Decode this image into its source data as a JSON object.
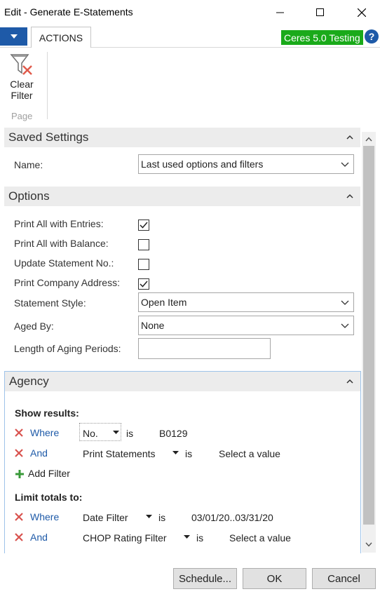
{
  "window": {
    "title": "Edit - Generate E-Statements",
    "minimize_icon": "minimize-icon",
    "maximize_icon": "maximize-icon",
    "close_icon": "close-icon"
  },
  "ribbon": {
    "menu_icon": "dropdown-arrow-icon",
    "tab_actions": "ACTIONS",
    "env_badge": "Ceres 5.0 Testing",
    "env_badge_color": "#1aaa1a",
    "help_icon": "help-icon",
    "help_glyph": "?",
    "clear_filter_line1": "Clear",
    "clear_filter_line2": "Filter",
    "group_label": "Page"
  },
  "saved_settings": {
    "title": "Saved Settings",
    "name_label": "Name:",
    "name_value": "Last used options and filters"
  },
  "options": {
    "title": "Options",
    "fields": [
      {
        "label": "Print All with Entries:",
        "checked": true
      },
      {
        "label": "Print All with Balance:",
        "checked": false
      },
      {
        "label": "Update Statement No.:",
        "checked": false
      },
      {
        "label": "Print Company Address:",
        "checked": true
      }
    ],
    "statement_style_label": "Statement Style:",
    "statement_style_value": "Open Item",
    "aged_by_label": "Aged By:",
    "aged_by_value": "None",
    "aging_periods_label": "Length of Aging Periods:",
    "aging_periods_value": ""
  },
  "agency": {
    "title": "Agency",
    "show_results_heading": "Show results:",
    "show_results": [
      {
        "keyword": "Where",
        "field": "No.",
        "op": "is",
        "value": "B0129"
      },
      {
        "keyword": "And",
        "field": "Print Statements",
        "op": "is",
        "value": "Select a value"
      }
    ],
    "add_filter_label": "Add Filter",
    "limit_totals_heading": "Limit totals to:",
    "limit_totals": [
      {
        "keyword": "Where",
        "field": "Date Filter",
        "op": "is",
        "value": "03/01/20..03/31/20"
      },
      {
        "keyword": "And",
        "field": "CHOP Rating Filter",
        "op": "is",
        "value": "Select a value"
      }
    ]
  },
  "footer": {
    "schedule_label": "Schedule...",
    "ok_label": "OK",
    "cancel_label": "Cancel"
  },
  "colors": {
    "accent": "#1e5aa8",
    "remove_icon": "#d9534f",
    "add_icon": "#3a9a3a"
  }
}
